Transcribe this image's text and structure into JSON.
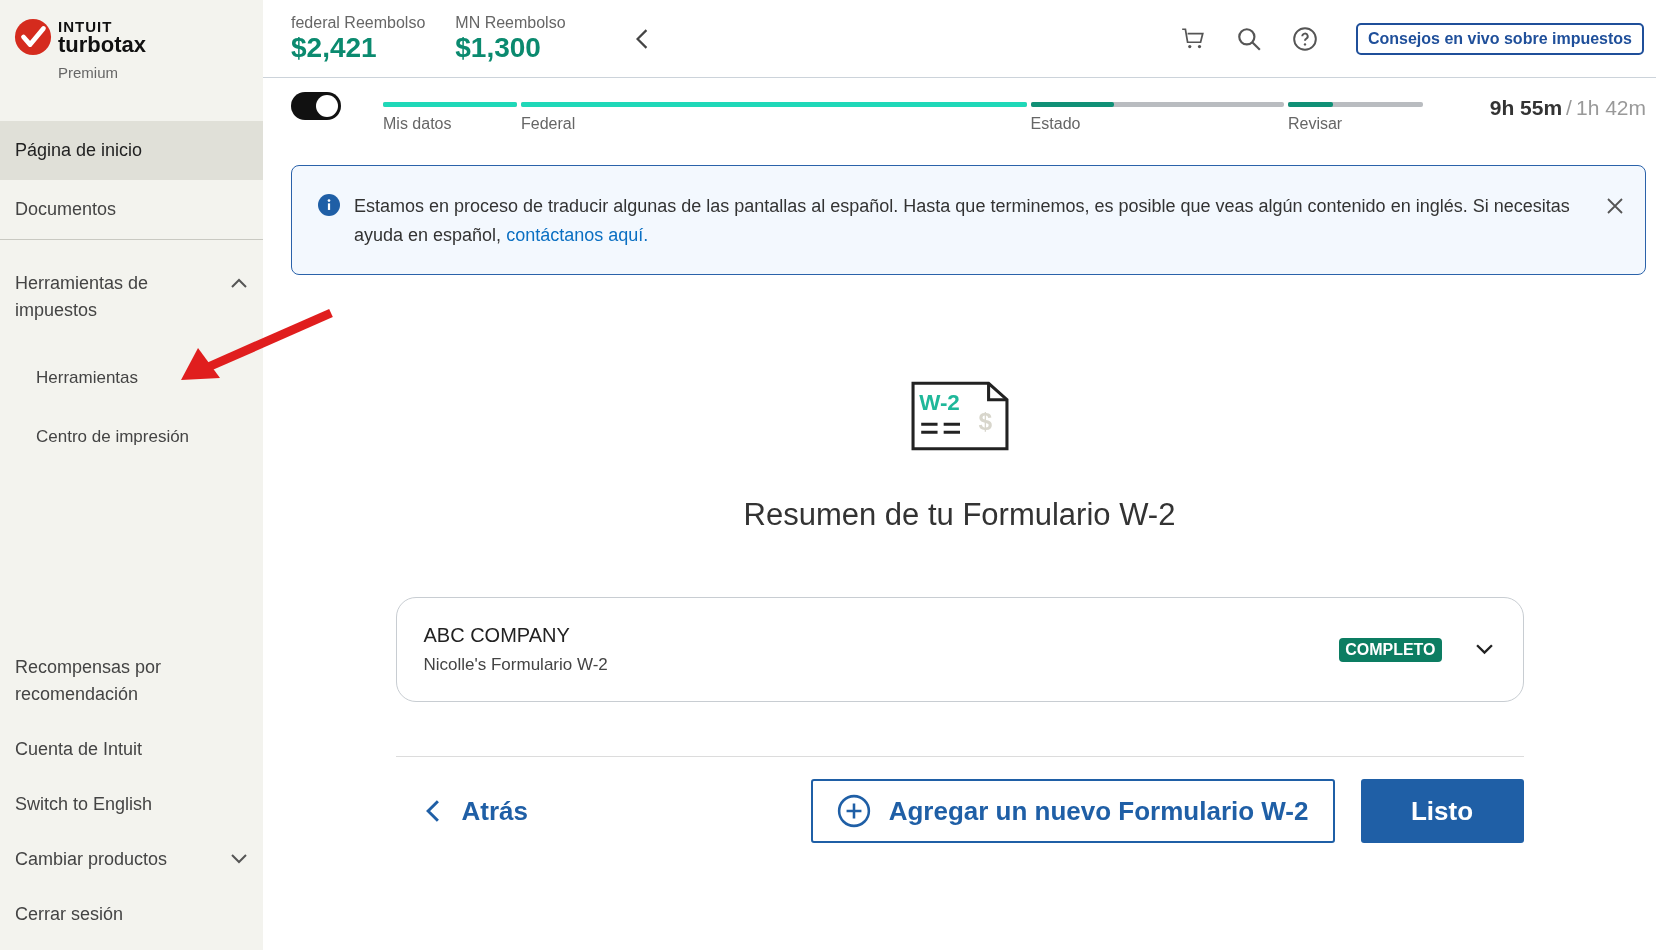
{
  "brand": {
    "company": "INTUIT",
    "product": "turbotax",
    "edition": "Premium"
  },
  "sidebar": {
    "items": [
      {
        "label": "Página de inicio",
        "selected": true
      },
      {
        "label": "Documentos",
        "selected": false
      }
    ],
    "groups": [
      {
        "label": "Herramientas de impuestos",
        "expanded": true,
        "children": [
          {
            "label": "Herramientas",
            "selected": false
          },
          {
            "label": "Centro de impresión",
            "selected": false
          }
        ]
      }
    ],
    "bottom_items": [
      {
        "label": "Recompensas por recomendación",
        "kind": "link"
      },
      {
        "label": "Cuenta de Intuit",
        "kind": "link"
      },
      {
        "label": "Switch to English",
        "kind": "link"
      },
      {
        "label": "Cambiar productos",
        "kind": "dropdown",
        "expanded": false
      },
      {
        "label": "Cerrar sesión",
        "kind": "link"
      }
    ]
  },
  "refunds": [
    {
      "label": "federal Reembolso",
      "amount": "$2,421"
    },
    {
      "label": "MN Reembolso",
      "amount": "$1,300"
    }
  ],
  "live_help_button": "Consejos en vivo sobre impuestos",
  "toggle": {
    "on": true
  },
  "progress": [
    {
      "label": "Mis datos",
      "level": 1
    },
    {
      "label": "Federal",
      "level": 1
    },
    {
      "label": "Estado",
      "level": 0.33
    },
    {
      "label": "Revisar",
      "level": 0.33
    }
  ],
  "timer": {
    "elapsed": "9h 55m",
    "separator": "/",
    "estimate": "1h 42m"
  },
  "banner": {
    "text": "Estamos en proceso de traducir algunas de las pantallas al español. Hasta que terminemos, es posible que veas algún contenido en inglés. Si necesitas ayuda en español,",
    "link": "contáctanos aquí."
  },
  "form_icon": {
    "label": "W-2",
    "symbol": "$"
  },
  "title": "Resumen de tu Formulario W-2",
  "cards": [
    {
      "employer": "ABC COMPANY",
      "subtitle": "Nicolle's Formulario W-2",
      "status": "COMPLETO",
      "expanded": false
    }
  ],
  "back_button": "Atrás",
  "add_button": "Agregar un nuevo Formulario W-2",
  "done_button": "Listo"
}
